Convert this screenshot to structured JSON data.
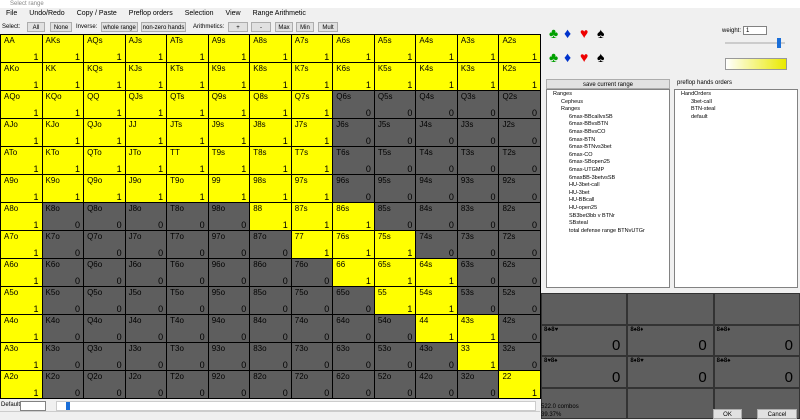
{
  "window": {
    "title": "Select range"
  },
  "menu": [
    "File",
    "Undo/Redo",
    "Copy / Paste",
    "Preflop orders",
    "Selection",
    "View",
    "Range Arithmetic"
  ],
  "toolbar": {
    "select_label": "Select:",
    "all": "All",
    "none": "None",
    "inverse_label": "Inverse:",
    "whole_range": "whole range",
    "nonzero": "non-zero hands",
    "arith_label": "Arithmetics:",
    "plus": "+",
    "minus": "-",
    "max": "Max",
    "min": "Min",
    "mult": "Mult"
  },
  "grid": {
    "rows": [
      [
        [
          "AA",
          "1",
          1
        ],
        [
          "AKs",
          "1",
          1
        ],
        [
          "AQs",
          "1",
          1
        ],
        [
          "AJs",
          "1",
          1
        ],
        [
          "ATs",
          "1",
          1
        ],
        [
          "A9s",
          "1",
          1
        ],
        [
          "A8s",
          "1",
          1
        ],
        [
          "A7s",
          "1",
          1
        ],
        [
          "A6s",
          "1",
          1
        ],
        [
          "A5s",
          "1",
          1
        ],
        [
          "A4s",
          "1",
          1
        ],
        [
          "A3s",
          "1",
          1
        ],
        [
          "A2s",
          "1",
          1
        ]
      ],
      [
        [
          "AKo",
          "1",
          1
        ],
        [
          "KK",
          "1",
          1
        ],
        [
          "KQs",
          "1",
          1
        ],
        [
          "KJs",
          "1",
          1
        ],
        [
          "KTs",
          "1",
          1
        ],
        [
          "K9s",
          "1",
          1
        ],
        [
          "K8s",
          "1",
          1
        ],
        [
          "K7s",
          "1",
          1
        ],
        [
          "K6s",
          "1",
          1
        ],
        [
          "K5s",
          "1",
          1
        ],
        [
          "K4s",
          "1",
          1
        ],
        [
          "K3s",
          "1",
          1
        ],
        [
          "K2s",
          "1",
          1
        ]
      ],
      [
        [
          "AQo",
          "1",
          1
        ],
        [
          "KQo",
          "1",
          1
        ],
        [
          "QQ",
          "1",
          1
        ],
        [
          "QJs",
          "1",
          1
        ],
        [
          "QTs",
          "1",
          1
        ],
        [
          "Q9s",
          "1",
          1
        ],
        [
          "Q8s",
          "1",
          1
        ],
        [
          "Q7s",
          "1",
          1
        ],
        [
          "Q6s",
          "0",
          0
        ],
        [
          "Q5s",
          "0",
          0
        ],
        [
          "Q4s",
          "0",
          0
        ],
        [
          "Q3s",
          "0",
          0
        ],
        [
          "Q2s",
          "0",
          0
        ]
      ],
      [
        [
          "AJo",
          "1",
          1
        ],
        [
          "KJo",
          "1",
          1
        ],
        [
          "QJo",
          "1",
          1
        ],
        [
          "JJ",
          "1",
          1
        ],
        [
          "JTs",
          "1",
          1
        ],
        [
          "J9s",
          "1",
          1
        ],
        [
          "J8s",
          "1",
          1
        ],
        [
          "J7s",
          "1",
          1
        ],
        [
          "J6s",
          "0",
          0
        ],
        [
          "J5s",
          "0",
          0
        ],
        [
          "J4s",
          "0",
          0
        ],
        [
          "J3s",
          "0",
          0
        ],
        [
          "J2s",
          "0",
          0
        ]
      ],
      [
        [
          "ATo",
          "1",
          1
        ],
        [
          "KTo",
          "1",
          1
        ],
        [
          "QTo",
          "1",
          1
        ],
        [
          "JTo",
          "1",
          1
        ],
        [
          "TT",
          "1",
          1
        ],
        [
          "T9s",
          "1",
          1
        ],
        [
          "T8s",
          "1",
          1
        ],
        [
          "T7s",
          "1",
          1
        ],
        [
          "T6s",
          "0",
          0
        ],
        [
          "T5s",
          "0",
          0
        ],
        [
          "T4s",
          "0",
          0
        ],
        [
          "T3s",
          "0",
          0
        ],
        [
          "T2s",
          "0",
          0
        ]
      ],
      [
        [
          "A9o",
          "1",
          1
        ],
        [
          "K9o",
          "1",
          1
        ],
        [
          "Q9o",
          "1",
          1
        ],
        [
          "J9o",
          "1",
          1
        ],
        [
          "T9o",
          "1",
          1
        ],
        [
          "99",
          "1",
          1
        ],
        [
          "98s",
          "1",
          1
        ],
        [
          "97s",
          "1",
          1
        ],
        [
          "96s",
          "0",
          0
        ],
        [
          "95s",
          "0",
          0
        ],
        [
          "94s",
          "0",
          0
        ],
        [
          "93s",
          "0",
          0
        ],
        [
          "92s",
          "0",
          0
        ]
      ],
      [
        [
          "A8o",
          "1",
          1
        ],
        [
          "K8o",
          "0",
          0
        ],
        [
          "Q8o",
          "0",
          0
        ],
        [
          "J8o",
          "0",
          0
        ],
        [
          "T8o",
          "0",
          0
        ],
        [
          "98o",
          "0",
          0
        ],
        [
          "88",
          "1",
          1
        ],
        [
          "87s",
          "1",
          1
        ],
        [
          "86s",
          "1",
          1
        ],
        [
          "85s",
          "0",
          0
        ],
        [
          "84s",
          "0",
          0
        ],
        [
          "83s",
          "0",
          0
        ],
        [
          "82s",
          "0",
          0
        ]
      ],
      [
        [
          "A7o",
          "1",
          1
        ],
        [
          "K7o",
          "0",
          0
        ],
        [
          "Q7o",
          "0",
          0
        ],
        [
          "J7o",
          "0",
          0
        ],
        [
          "T7o",
          "0",
          0
        ],
        [
          "97o",
          "0",
          0
        ],
        [
          "87o",
          "0",
          0
        ],
        [
          "77",
          "1",
          1
        ],
        [
          "76s",
          "1",
          1
        ],
        [
          "75s",
          "1",
          1
        ],
        [
          "74s",
          "0",
          0
        ],
        [
          "73s",
          "0",
          0
        ],
        [
          "72s",
          "0",
          0
        ]
      ],
      [
        [
          "A6o",
          "1",
          1
        ],
        [
          "K6o",
          "0",
          0
        ],
        [
          "Q6o",
          "0",
          0
        ],
        [
          "J6o",
          "0",
          0
        ],
        [
          "T6o",
          "0",
          0
        ],
        [
          "96o",
          "0",
          0
        ],
        [
          "86o",
          "0",
          0
        ],
        [
          "76o",
          "0",
          0
        ],
        [
          "66",
          "1",
          1
        ],
        [
          "65s",
          "1",
          1
        ],
        [
          "64s",
          "1",
          1
        ],
        [
          "63s",
          "0",
          0
        ],
        [
          "62s",
          "0",
          0
        ]
      ],
      [
        [
          "A5o",
          "1",
          1
        ],
        [
          "K5o",
          "0",
          0
        ],
        [
          "Q5o",
          "0",
          0
        ],
        [
          "J5o",
          "0",
          0
        ],
        [
          "T5o",
          "0",
          0
        ],
        [
          "95o",
          "0",
          0
        ],
        [
          "85o",
          "0",
          0
        ],
        [
          "75o",
          "0",
          0
        ],
        [
          "65o",
          "0",
          0
        ],
        [
          "55",
          "1",
          1
        ],
        [
          "54s",
          "1",
          1
        ],
        [
          "53s",
          "0",
          0
        ],
        [
          "52s",
          "0",
          0
        ]
      ],
      [
        [
          "A4o",
          "1",
          1
        ],
        [
          "K4o",
          "0",
          0
        ],
        [
          "Q4o",
          "0",
          0
        ],
        [
          "J4o",
          "0",
          0
        ],
        [
          "T4o",
          "0",
          0
        ],
        [
          "94o",
          "0",
          0
        ],
        [
          "84o",
          "0",
          0
        ],
        [
          "74o",
          "0",
          0
        ],
        [
          "64o",
          "0",
          0
        ],
        [
          "54o",
          "0",
          0
        ],
        [
          "44",
          "1",
          1
        ],
        [
          "43s",
          "1",
          1
        ],
        [
          "42s",
          "0",
          0
        ]
      ],
      [
        [
          "A3o",
          "1",
          1
        ],
        [
          "K3o",
          "0",
          0
        ],
        [
          "Q3o",
          "0",
          0
        ],
        [
          "J3o",
          "0",
          0
        ],
        [
          "T3o",
          "0",
          0
        ],
        [
          "93o",
          "0",
          0
        ],
        [
          "83o",
          "0",
          0
        ],
        [
          "73o",
          "0",
          0
        ],
        [
          "63o",
          "0",
          0
        ],
        [
          "53o",
          "0",
          0
        ],
        [
          "43o",
          "0",
          0
        ],
        [
          "33",
          "1",
          1
        ],
        [
          "32s",
          "0",
          0
        ]
      ],
      [
        [
          "A2o",
          "1",
          1
        ],
        [
          "K2o",
          "0",
          0
        ],
        [
          "Q2o",
          "0",
          0
        ],
        [
          "J2o",
          "0",
          0
        ],
        [
          "T2o",
          "0",
          0
        ],
        [
          "92o",
          "0",
          0
        ],
        [
          "82o",
          "0",
          0
        ],
        [
          "72o",
          "0",
          0
        ],
        [
          "62o",
          "0",
          0
        ],
        [
          "52o",
          "0",
          0
        ],
        [
          "42o",
          "0",
          0
        ],
        [
          "32o",
          "0",
          0
        ],
        [
          "22",
          "1",
          1
        ]
      ]
    ]
  },
  "bottom": {
    "default_label": "Default",
    "combos": "522.0 combos",
    "pct": "39.37%",
    "ok": "OK",
    "cancel": "Cancel"
  },
  "right": {
    "weight_label": "weight:",
    "weight_value": "1",
    "save_btn": "save current range",
    "orders_label": "preflop hands orders",
    "ranges_tree": [
      "Ranges",
      "Cepheus",
      "Ranges",
      "6max-BBcallvsSB",
      "6max-BBvsBTN",
      "6max-BBvsCO",
      "6max-BTN",
      "6max-BTNvs3bet",
      "6max-CO",
      "6max-SBopen25",
      "6max-UTGMP",
      "6maxBB-3betvsSB",
      "HU-3bet-call",
      "HU-3bet",
      "HU-BBcall",
      "HU-open25",
      "SB3bet3bb v BTNr",
      "SBsteal",
      "total defense range BTNvUTGr"
    ],
    "orders_tree": [
      "HandOrders",
      "3bet-call",
      "BTN-steal",
      "default"
    ],
    "combo_boxes": [
      {
        "label": "8♣8♥",
        "value": "0"
      },
      {
        "label": "8♠8♦",
        "value": "0"
      },
      {
        "label": "8♣8♦",
        "value": "0"
      },
      {
        "label": "8♥8♠",
        "value": "0"
      },
      {
        "label": "8♦8♥",
        "value": "0"
      },
      {
        "label": "8♣8♠",
        "value": "0"
      }
    ]
  },
  "colors": {
    "on": "#ffff00",
    "off": "#5e5e5e"
  }
}
